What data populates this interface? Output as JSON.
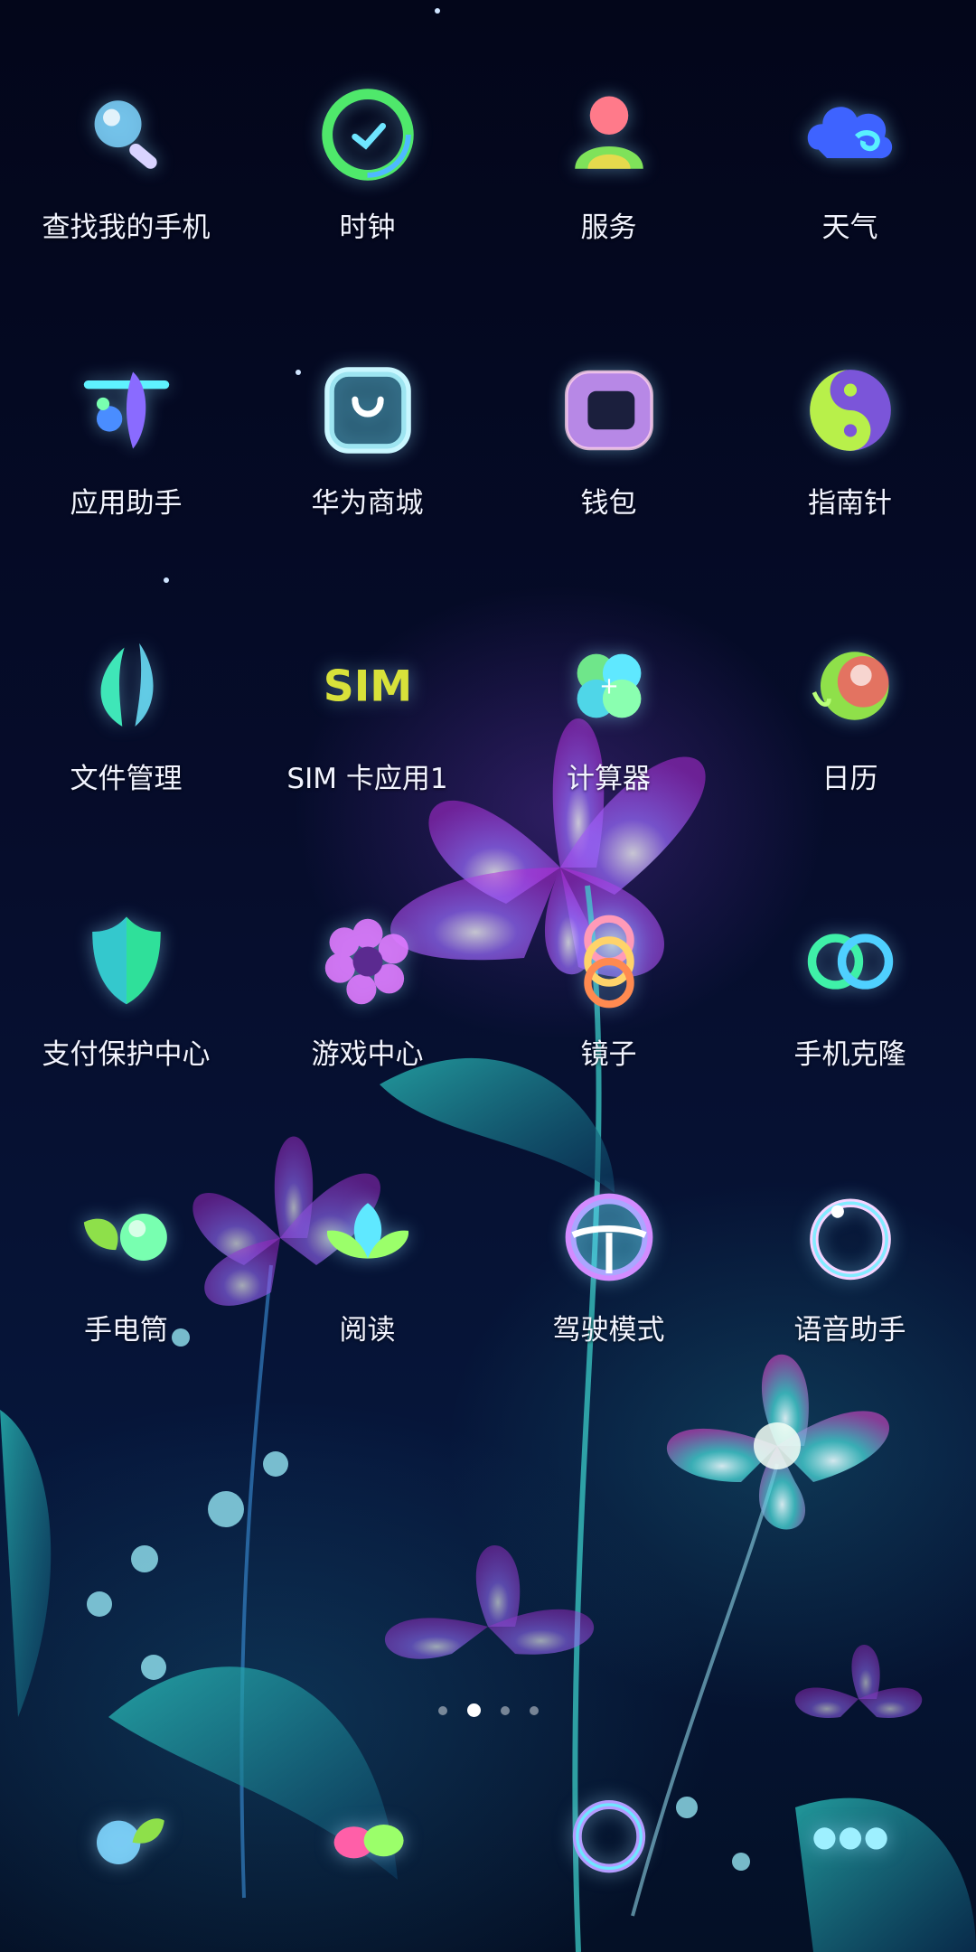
{
  "apps": [
    {
      "label": "查找我的手机",
      "icon": "magnifier-icon"
    },
    {
      "label": "时钟",
      "icon": "clock-icon"
    },
    {
      "label": "服务",
      "icon": "person-icon"
    },
    {
      "label": "天气",
      "icon": "cloud-icon"
    },
    {
      "label": "应用助手",
      "icon": "app-assistant-icon"
    },
    {
      "label": "华为商城",
      "icon": "shopping-bag-icon"
    },
    {
      "label": "钱包",
      "icon": "wallet-icon"
    },
    {
      "label": "指南针",
      "icon": "yin-yang-icon"
    },
    {
      "label": "文件管理",
      "icon": "leaf-icon"
    },
    {
      "label": "SIM 卡应用1",
      "icon": "sim-icon"
    },
    {
      "label": "计算器",
      "icon": "clover-calculator-icon"
    },
    {
      "label": "日历",
      "icon": "orb-icon"
    },
    {
      "label": "支付保护中心",
      "icon": "shield-icon"
    },
    {
      "label": "游戏中心",
      "icon": "flower-icon"
    },
    {
      "label": "镜子",
      "icon": "rings-vertical-icon"
    },
    {
      "label": "手机克隆",
      "icon": "rings-horizontal-icon"
    },
    {
      "label": "手电筒",
      "icon": "leaf-orb-icon"
    },
    {
      "label": "阅读",
      "icon": "lotus-icon"
    },
    {
      "label": "驾驶模式",
      "icon": "steering-wheel-icon"
    },
    {
      "label": "语音助手",
      "icon": "ring-icon"
    }
  ],
  "sim_text": "SIM",
  "page_indicator": {
    "count": 4,
    "active_index": 1
  },
  "dock": [
    {
      "icon": "phone-bubble-icon"
    },
    {
      "icon": "messages-bubble-icon"
    },
    {
      "icon": "browser-ring-icon"
    },
    {
      "icon": "more-dots-icon"
    }
  ],
  "colors": {
    "accent_cyan": "#5fe8ff",
    "accent_magenta": "#d04cff",
    "accent_green": "#6dff8a"
  }
}
